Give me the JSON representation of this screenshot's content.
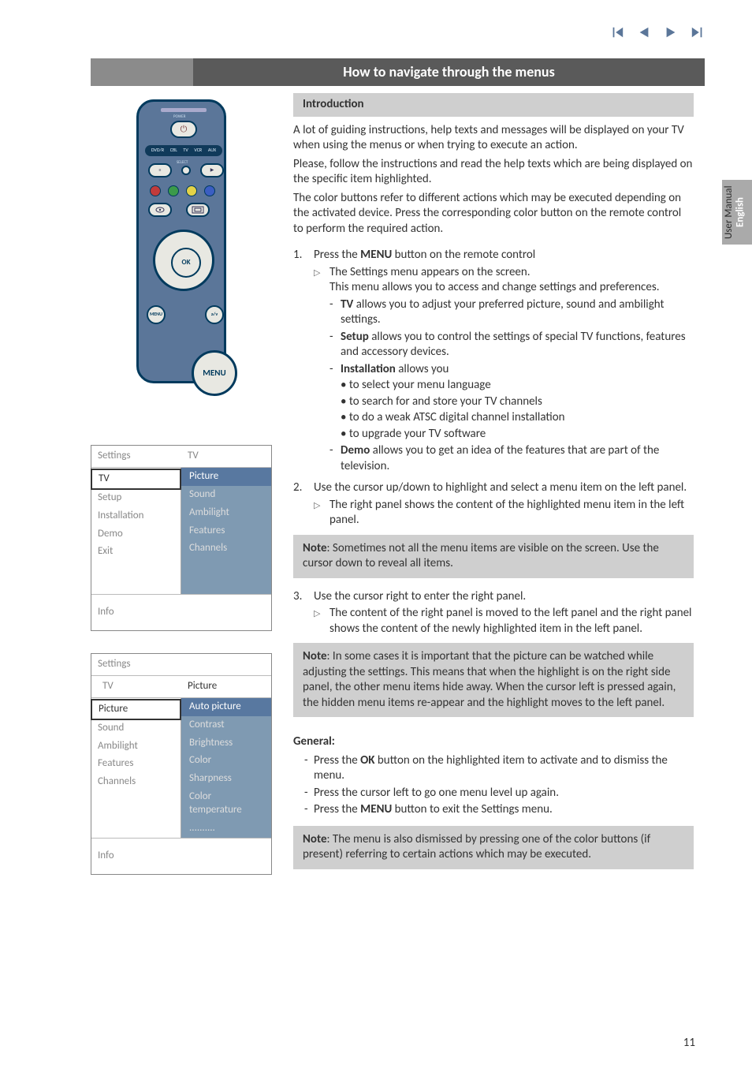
{
  "nav": {
    "first": "⏮",
    "prev": "◀",
    "next": "▶",
    "last": "⏭"
  },
  "header": {
    "title": "How to navigate through the menus"
  },
  "lang_tab": {
    "lang": "English",
    "sub": "User Manual"
  },
  "remote": {
    "power_label": "POWER",
    "devices": [
      "DVD/R",
      "CBL",
      "TV",
      "VCR",
      "AUX"
    ],
    "select": "SELECT",
    "ok": "OK",
    "menu_small": "MENU",
    "av": "a/v",
    "menu_callout": "MENU"
  },
  "menu1": {
    "head_left": "Settings",
    "head_right": "TV",
    "left": [
      "TV",
      "Setup",
      "Installation",
      "Demo",
      "Exit"
    ],
    "selected_left_index": 0,
    "right": [
      "Picture",
      "Sound",
      "Ambilight",
      "Features",
      "Channels"
    ],
    "info": "Info"
  },
  "menu2": {
    "head_left": "Settings",
    "head_mid": "TV",
    "head_right": "Picture",
    "left": [
      "Picture",
      "Sound",
      "Ambilight",
      "Features",
      "Channels"
    ],
    "selected_left_index": 0,
    "right": [
      "Auto picture",
      "Contrast",
      "Brightness",
      "Color",
      "Sharpness",
      "Color temperature",
      ".........."
    ],
    "info": "Info"
  },
  "intro": {
    "heading": "Introduction",
    "p1": "A lot of guiding instructions, help texts and messages will be displayed on your TV when using the menus or when trying to execute an action.",
    "p2": "Please, follow the instructions and read the help texts which are being displayed on the specific item highlighted.",
    "p3": "The color buttons refer to different actions which may be executed depending on the activated device. Press the corresponding color button on the remote control to perform the required action."
  },
  "steps": {
    "s1": {
      "num": "1.",
      "text_pre": "Press the ",
      "bold": "MENU",
      "text_post": " button on the remote control"
    },
    "s1_sub": "The Settings menu appears on the screen.",
    "s1_sub2": "This menu allows you to access and change settings and preferences.",
    "s1_tv_b": "TV",
    "s1_tv_t": " allows you to adjust your preferred picture, sound and ambilight settings.",
    "s1_setup_b": "Setup",
    "s1_setup_t": " allows you to control the settings of special TV functions, features and accessory devices.",
    "s1_inst_b": "Installation",
    "s1_inst_t": " allows you",
    "s1_inst_bullets": [
      "• to select your menu language",
      "• to search for and store your TV channels",
      "• to do a weak ATSC digital channel installation",
      "• to upgrade your TV software"
    ],
    "s1_demo_b": "Demo",
    "s1_demo_t": " allows you to get an idea of the features that are part of the television.",
    "s2": {
      "num": "2.",
      "text": "Use the cursor up/down to highlight and select a menu item on the left panel."
    },
    "s2_sub": "The right panel shows the content of the highlighted menu item in the left panel.",
    "note1_b": "Note",
    "note1_t": ": Sometimes not all the menu items are visible on the screen. Use the cursor down to reveal all items.",
    "s3": {
      "num": "3.",
      "text": "Use the cursor right to enter the right panel."
    },
    "s3_sub": "The content of the right panel is moved to the left panel and the right panel shows the content of the newly highlighted item in the left panel.",
    "note2_b": "Note",
    "note2_t": ": In some cases it is important that the picture can be watched while adjusting the settings. This means that when the highlight is on the right side panel, the other menu items hide away. When the cursor left is pressed again, the hidden menu items re-appear and the highlight moves to the left panel."
  },
  "general": {
    "heading": "General:",
    "g1_pre": "Press the ",
    "g1_b": "OK",
    "g1_post": " button on the highlighted item to activate and to dismiss the menu.",
    "g2": "Press the cursor left to go one menu level up again.",
    "g3_pre": "Press the ",
    "g3_b": "MENU",
    "g3_post": " button to exit the Settings menu.",
    "note_b": "Note",
    "note_t": ": The menu is also dismissed by pressing one of the color buttons (if present) referring to certain actions which may be executed."
  },
  "page_number": "11"
}
